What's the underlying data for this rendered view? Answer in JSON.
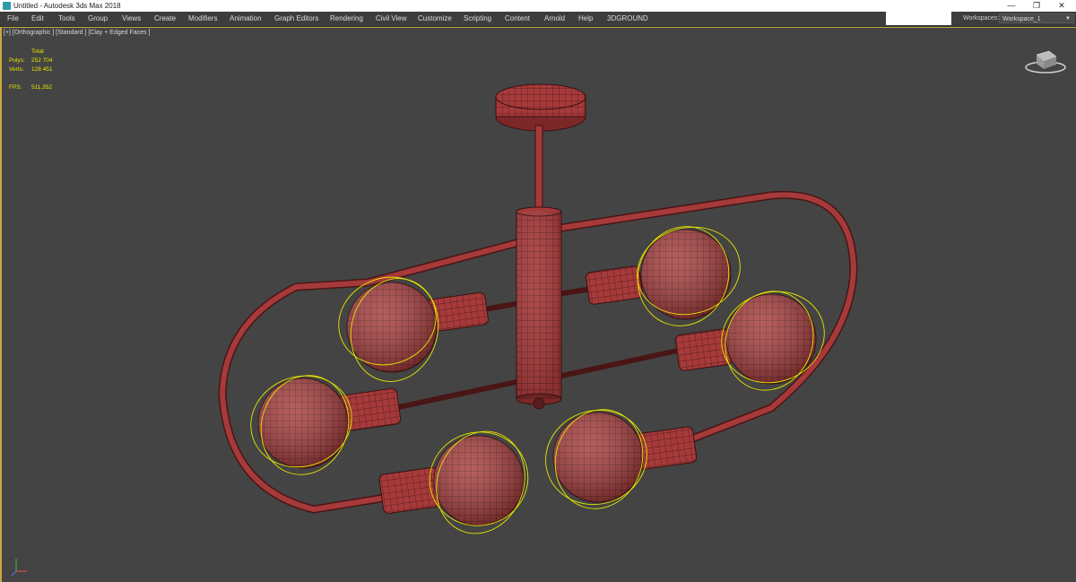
{
  "window": {
    "title": "Untitled - Autodesk 3ds Max 2018",
    "minimize": "—",
    "restore": "❐",
    "close": "✕"
  },
  "menu": [
    "File",
    "Edit",
    "Tools",
    "Group",
    "Views",
    "Create",
    "Modifiers",
    "Animation",
    "Graph Editors",
    "Rendering",
    "Civil View",
    "Customize",
    "Scripting",
    "Content",
    "Arnold",
    "Help",
    "3DGROUND"
  ],
  "workspace": {
    "label": "Workspaces:",
    "value": "Workspace_1"
  },
  "viewport": {
    "label": "[+] [Orthographic ] [Standard ] [Clay + Edged Faces ]",
    "stats": {
      "header": "Total",
      "polys_label": "Polys:",
      "polys": "252 704",
      "verts_label": "Verts:",
      "verts": "128 451",
      "fps_label": "FPS:",
      "fps": "511,352"
    }
  },
  "colors": {
    "accent": "#c9a83a",
    "mesh": "#a63a3a",
    "wire": "#4a1515",
    "selection": "#e6e600",
    "viewport_bg": "#444444"
  }
}
